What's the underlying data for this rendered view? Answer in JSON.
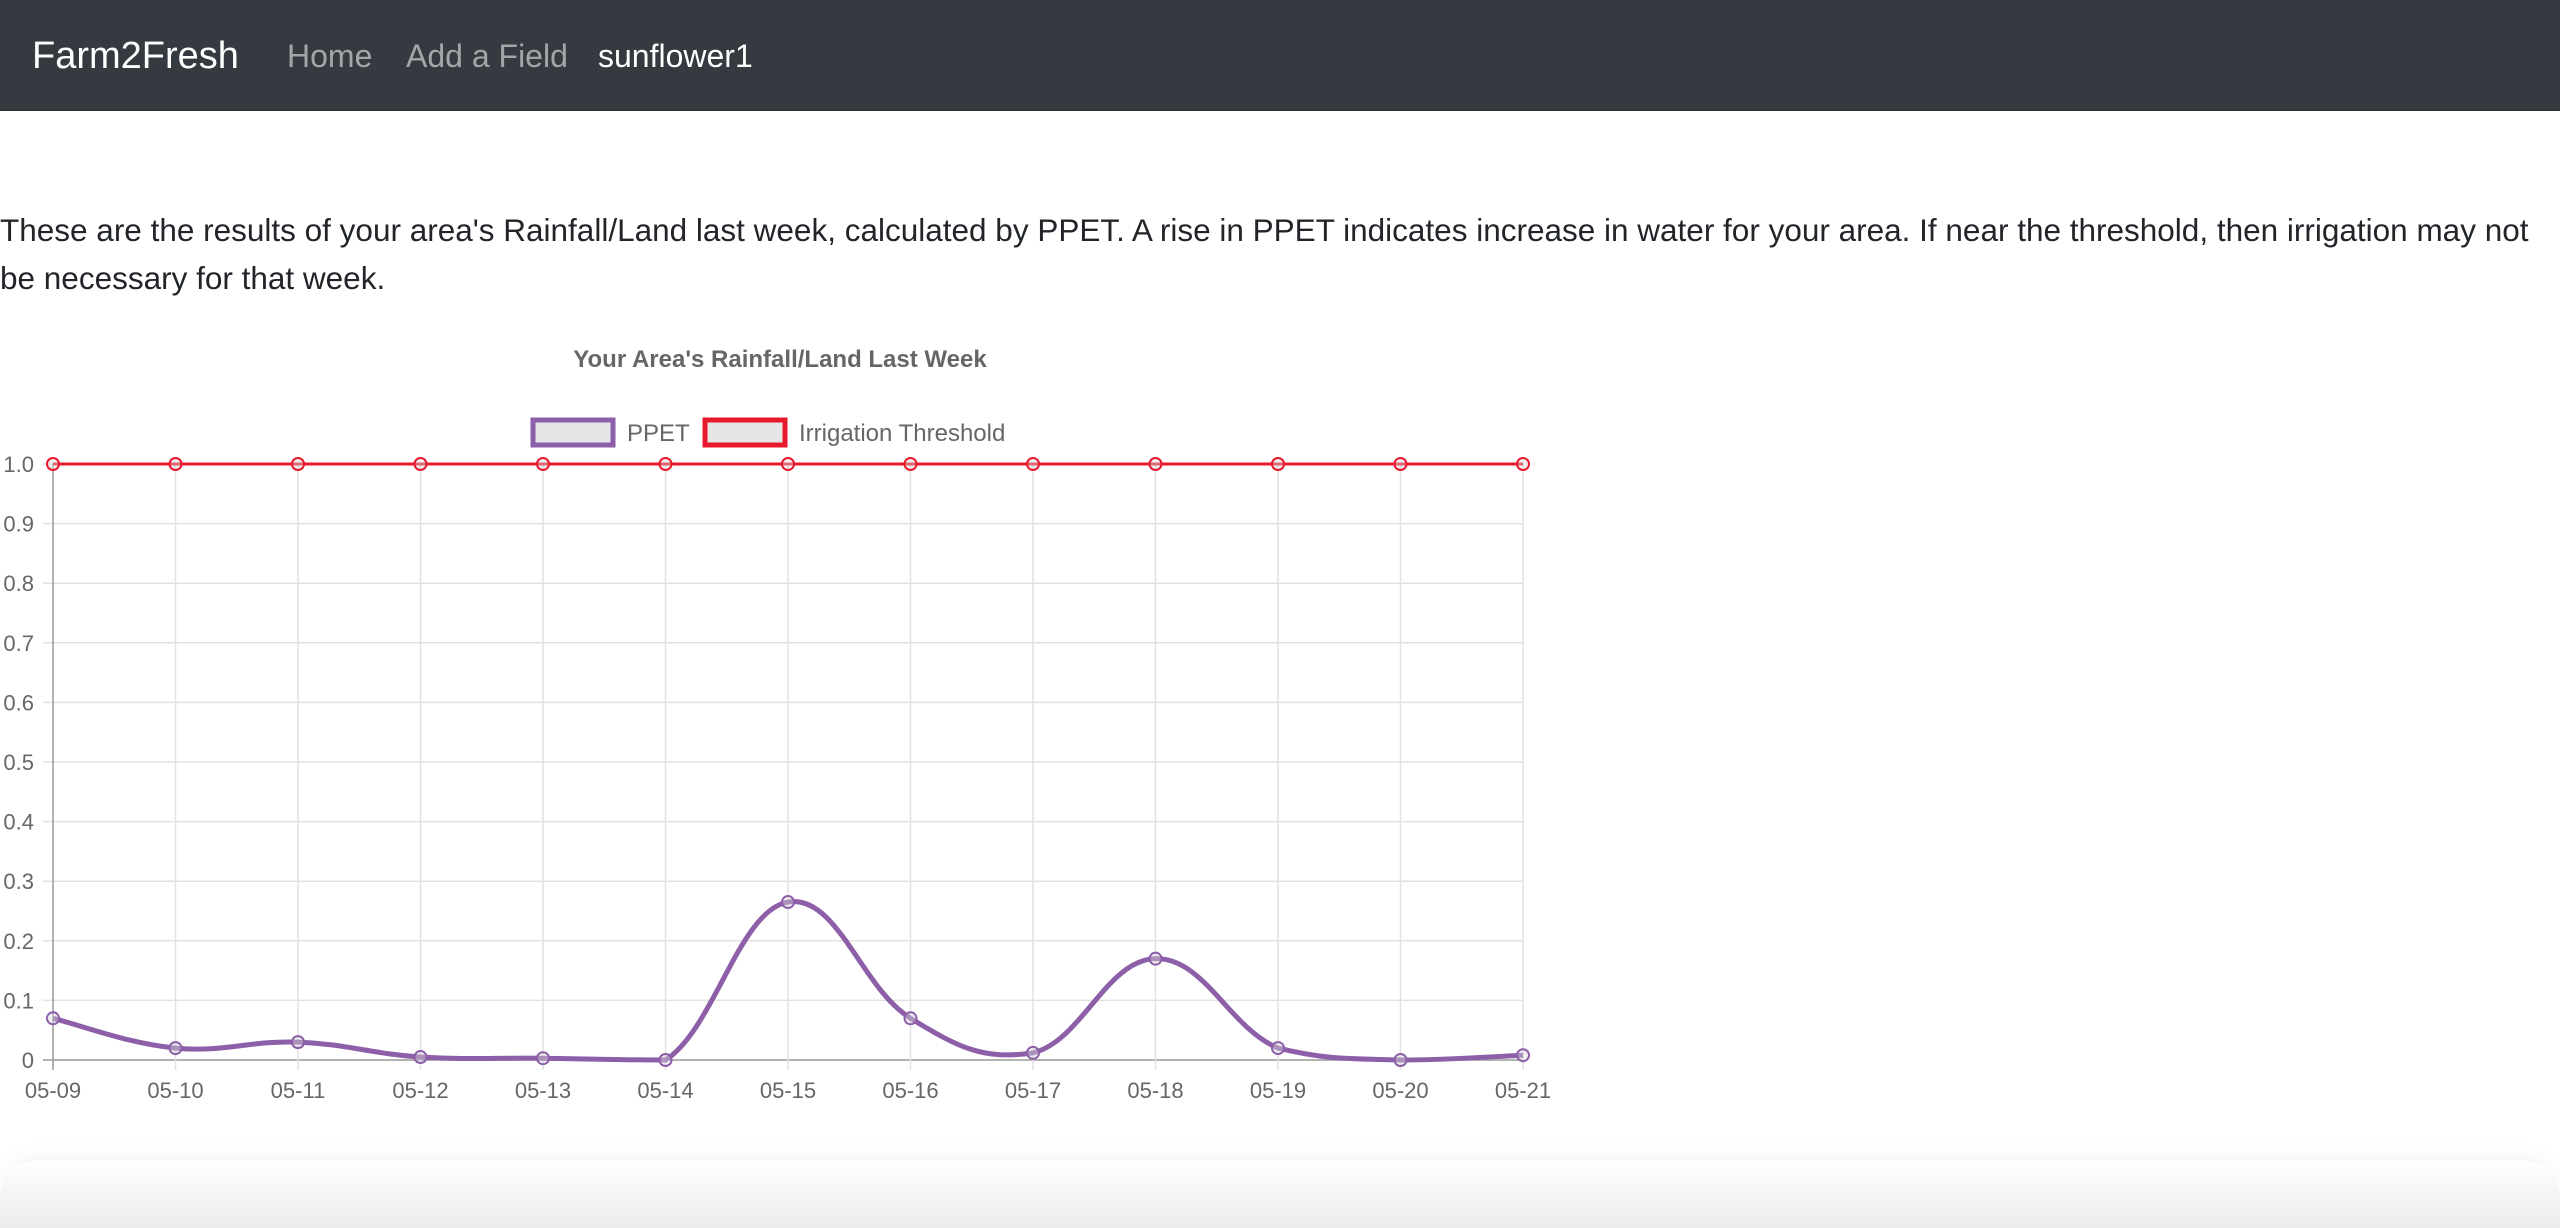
{
  "navbar": {
    "brand": "Farm2Fresh",
    "links": [
      {
        "label": "Home",
        "active": false
      },
      {
        "label": "Add a Field",
        "active": false
      },
      {
        "label": "sunflower1",
        "active": true
      }
    ]
  },
  "description": "These are the results of your area's Rainfall/Land last week, calculated by PPET. A rise in PPET indicates increase in water for your area. If near the threshold, then irrigation may not be necessary for that week.",
  "chart_data": {
    "type": "line",
    "title": "Your Area's Rainfall/Land Last Week",
    "categories": [
      "05-09",
      "05-10",
      "05-11",
      "05-12",
      "05-13",
      "05-14",
      "05-15",
      "05-16",
      "05-17",
      "05-18",
      "05-19",
      "05-20",
      "05-21"
    ],
    "series": [
      {
        "name": "PPET",
        "color": "#8c5fa8",
        "values": [
          0.07,
          0.02,
          0.03,
          0.005,
          0.003,
          0.0,
          0.265,
          0.07,
          0.012,
          0.17,
          0.02,
          0.0,
          0.008
        ]
      },
      {
        "name": "Irrigation Threshold",
        "color": "#e8192c",
        "values": [
          1.0,
          1.0,
          1.0,
          1.0,
          1.0,
          1.0,
          1.0,
          1.0,
          1.0,
          1.0,
          1.0,
          1.0,
          1.0
        ]
      }
    ],
    "yticks": [
      "0",
      "0.1",
      "0.2",
      "0.3",
      "0.4",
      "0.5",
      "0.6",
      "0.7",
      "0.8",
      "0.9",
      "1.0"
    ],
    "ylim": [
      0,
      1.0
    ],
    "grid": true,
    "legend": "top-center"
  }
}
